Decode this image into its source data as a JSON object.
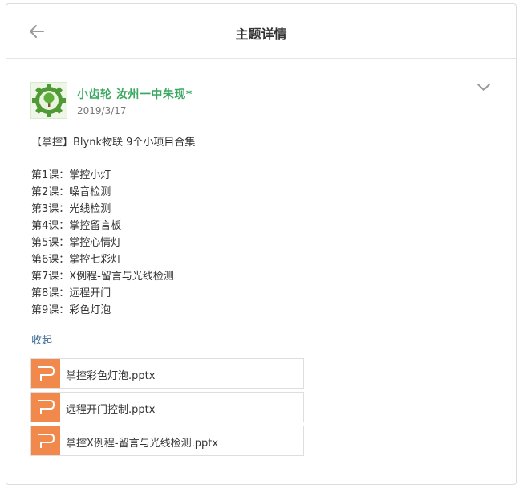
{
  "header": {
    "title": "主题详情"
  },
  "post": {
    "author": "小齿轮 汝州一中朱现*",
    "date": "2019/3/17",
    "intro": "【掌控】Blynk物联  9个小项目合集",
    "lessons": [
      "第1课：掌控小灯",
      "第2课：噪音检测",
      "第3课：光线检测",
      "第4课：掌控留言板",
      "第5课：掌控心情灯",
      "第6课：掌控七彩灯",
      "第7课：X例程-留言与光线检测",
      "第8课：远程开门",
      "第9课：彩色灯泡"
    ],
    "collapse_label": "收起",
    "attachments": [
      {
        "name": "掌控彩色灯泡.pptx",
        "icon": "pptx-file-icon"
      },
      {
        "name": "远程开门控制.pptx",
        "icon": "pptx-file-icon"
      },
      {
        "name": "掌控X例程-留言与光线检测.pptx",
        "icon": "pptx-file-icon"
      }
    ]
  },
  "colors": {
    "author": "#3ba861",
    "link": "#3f6c95",
    "pptx_icon": "#f0894b"
  }
}
